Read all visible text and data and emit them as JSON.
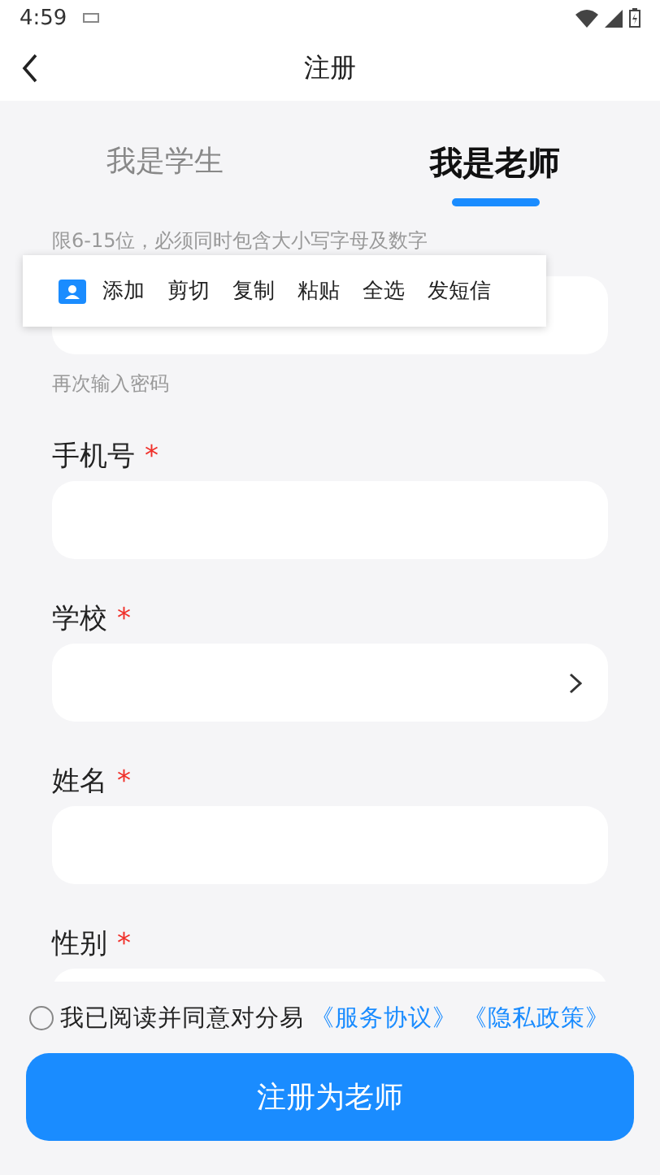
{
  "status_bar": {
    "time": "4:59"
  },
  "header": {
    "title": "注册"
  },
  "tabs": [
    {
      "label": "我是学生",
      "selected": false
    },
    {
      "label": "我是老师",
      "selected": true
    }
  ],
  "password_hint": "限6-15位，必须同时包含大小写字母及数字",
  "context_menu": {
    "items": [
      "添加",
      "剪切",
      "复制",
      "粘贴",
      "全选",
      "发短信"
    ]
  },
  "confirm_hint": "再次输入密码",
  "fields": [
    {
      "label": "手机号",
      "required_mark": "*",
      "kind": "text"
    },
    {
      "label": "学校",
      "required_mark": "*",
      "kind": "picker"
    },
    {
      "label": "姓名",
      "required_mark": "*",
      "kind": "text"
    },
    {
      "label": "性别",
      "required_mark": "*",
      "kind": "text"
    }
  ],
  "agreement": {
    "checked": false,
    "text": "我已阅读并同意对分易",
    "links": [
      "《服务协议》",
      "《隐私政策》"
    ]
  },
  "submit_button": "注册为老师"
}
